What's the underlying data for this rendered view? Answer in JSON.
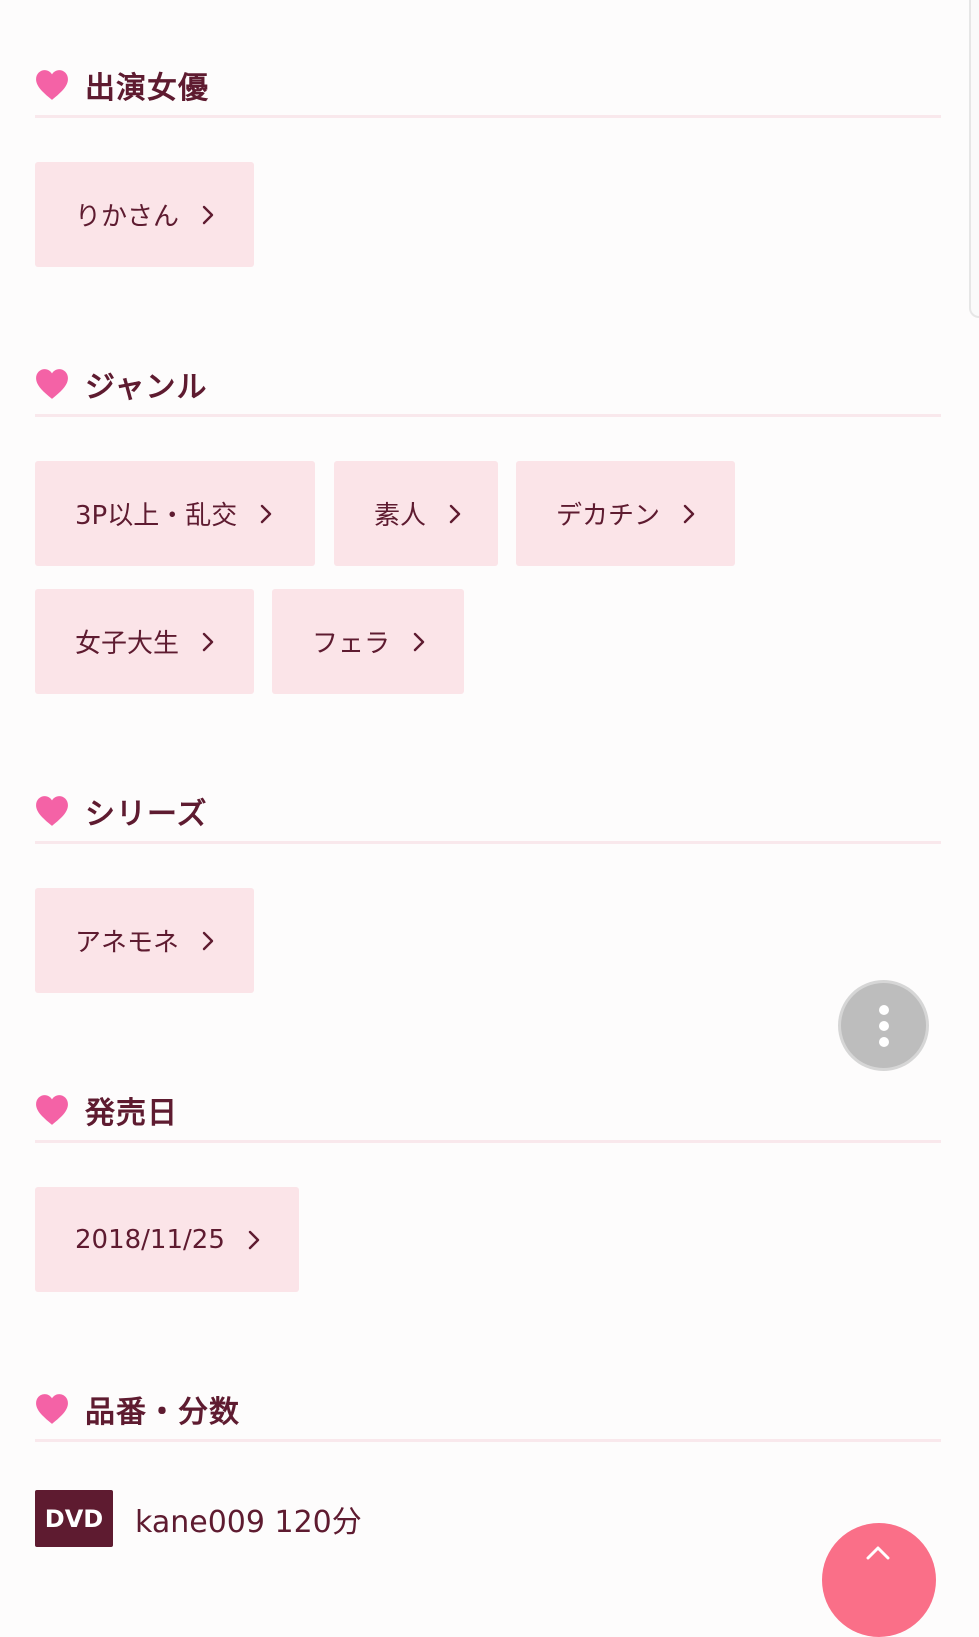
{
  "colors": {
    "heart": "#f462a6",
    "chip_bg": "#fbe4e8",
    "text": "#5e1b30",
    "fab_top": "#fa6f88",
    "fab_more": "#bdbdbd"
  },
  "sections": {
    "actress": {
      "title": "出演女優",
      "chips": [
        "りかさん"
      ]
    },
    "genre": {
      "title": "ジャンル",
      "chips": [
        "3P以上・乱交",
        "素人",
        "デカチン",
        "女子大生",
        "フェラ"
      ]
    },
    "series": {
      "title": "シリーズ",
      "chips": [
        "アネモネ"
      ]
    },
    "release": {
      "title": "発売日",
      "chips": [
        "2018/11/25"
      ]
    },
    "product": {
      "title": "品番・分数",
      "badge": "DVD",
      "value": "kane009 120分"
    }
  },
  "icons": {
    "section_icon": "heart-icon",
    "chip_icon": "chevron-right-icon",
    "more_button_icon": "more-vertical-icon",
    "top_button_icon": "chevron-up-icon"
  }
}
